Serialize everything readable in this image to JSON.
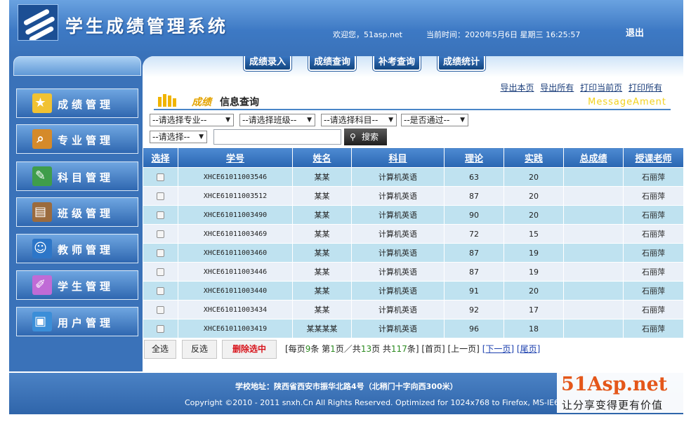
{
  "header": {
    "title": "学生成绩管理系统",
    "welcome": "欢迎您，51asp.net",
    "current_time": "当前时间：2020年5月6日 星期三 16:25:57",
    "logout": "退出"
  },
  "sidebar": {
    "items": [
      {
        "label": "成绩管理",
        "icon": "folder-star-icon",
        "color": "#f1c232"
      },
      {
        "label": "专业管理",
        "icon": "clipboard-search-icon",
        "color": "#d58a2a"
      },
      {
        "label": "科目管理",
        "icon": "notepad-pen-icon",
        "color": "#3f9d4b"
      },
      {
        "label": "班级管理",
        "icon": "classroom-icon",
        "color": "#9b6b3e"
      },
      {
        "label": "教师管理",
        "icon": "teacher-icon",
        "color": "#2d76c8"
      },
      {
        "label": "学生管理",
        "icon": "student-icon",
        "color": "#c06bd6"
      },
      {
        "label": "用户管理",
        "icon": "computer-user-icon",
        "color": "#3b8ed8"
      }
    ]
  },
  "top_tabs": [
    "成绩录入",
    "成绩查询",
    "补考查询",
    "成绩统计"
  ],
  "exports": [
    "导出本页",
    "导出所有",
    "打印当前页",
    "打印所有"
  ],
  "section": {
    "title_prefix": "成绩",
    "title": "信息查询",
    "watermark": "MessageAment"
  },
  "filters": {
    "major": "--请选择专业--",
    "class": "--请选择班级--",
    "subject": "--请选择科目--",
    "passed": "--是否通过--",
    "other": "--请选择--",
    "search_value": "",
    "search_button": "搜索"
  },
  "table": {
    "columns": [
      "选择",
      "学号",
      "姓名",
      "科目",
      "理论",
      "实践",
      "总成绩",
      "授课老师"
    ],
    "rows": [
      {
        "id": "XHCE61011003546",
        "name": "某某",
        "subject": "计算机英语",
        "theory": "63",
        "practice": "20",
        "total": "",
        "teacher": "石丽萍"
      },
      {
        "id": "XHCE61011003512",
        "name": "某某",
        "subject": "计算机英语",
        "theory": "87",
        "practice": "20",
        "total": "",
        "teacher": "石丽萍"
      },
      {
        "id": "XHCE61011003490",
        "name": "某某",
        "subject": "计算机英语",
        "theory": "90",
        "practice": "20",
        "total": "",
        "teacher": "石丽萍"
      },
      {
        "id": "XHCE61011003469",
        "name": "某某",
        "subject": "计算机英语",
        "theory": "72",
        "practice": "15",
        "total": "",
        "teacher": "石丽萍"
      },
      {
        "id": "XHCE61011003460",
        "name": "某某",
        "subject": "计算机英语",
        "theory": "87",
        "practice": "19",
        "total": "",
        "teacher": "石丽萍"
      },
      {
        "id": "XHCE61011003446",
        "name": "某某",
        "subject": "计算机英语",
        "theory": "87",
        "practice": "19",
        "total": "",
        "teacher": "石丽萍"
      },
      {
        "id": "XHCE61011003440",
        "name": "某某",
        "subject": "计算机英语",
        "theory": "91",
        "practice": "20",
        "total": "",
        "teacher": "石丽萍"
      },
      {
        "id": "XHCE61011003434",
        "name": "某某",
        "subject": "计算机英语",
        "theory": "92",
        "practice": "17",
        "total": "",
        "teacher": "石丽萍"
      },
      {
        "id": "XHCE61011003419",
        "name": "某某某某",
        "subject": "计算机英语",
        "theory": "96",
        "practice": "18",
        "total": "",
        "teacher": "石丽萍"
      }
    ]
  },
  "actions": {
    "select_all": "全选",
    "invert": "反选",
    "delete": "删除选中"
  },
  "pager": {
    "p1": "[每页",
    "per_page": "9",
    "p2": "条 第",
    "page": "1",
    "p3": "页／共",
    "total_pages": "13",
    "p4": "页 共",
    "total": "117",
    "p5": "条] [首页] [上一页]",
    "next": "[下一页]",
    "last": "[尾页]"
  },
  "footer": {
    "address": "学校地址：陕西省西安市振华北路4号（北稍门十字向西300米）",
    "copyright": "Copyright ©2010 - 2011 snxh.Cn All Rights Reserved. Optimized for 1024x768 to Firefox, MS-IE6 II"
  },
  "watermark": {
    "brand": "51Asp.net",
    "slogan": "让分享变得更有价值"
  }
}
